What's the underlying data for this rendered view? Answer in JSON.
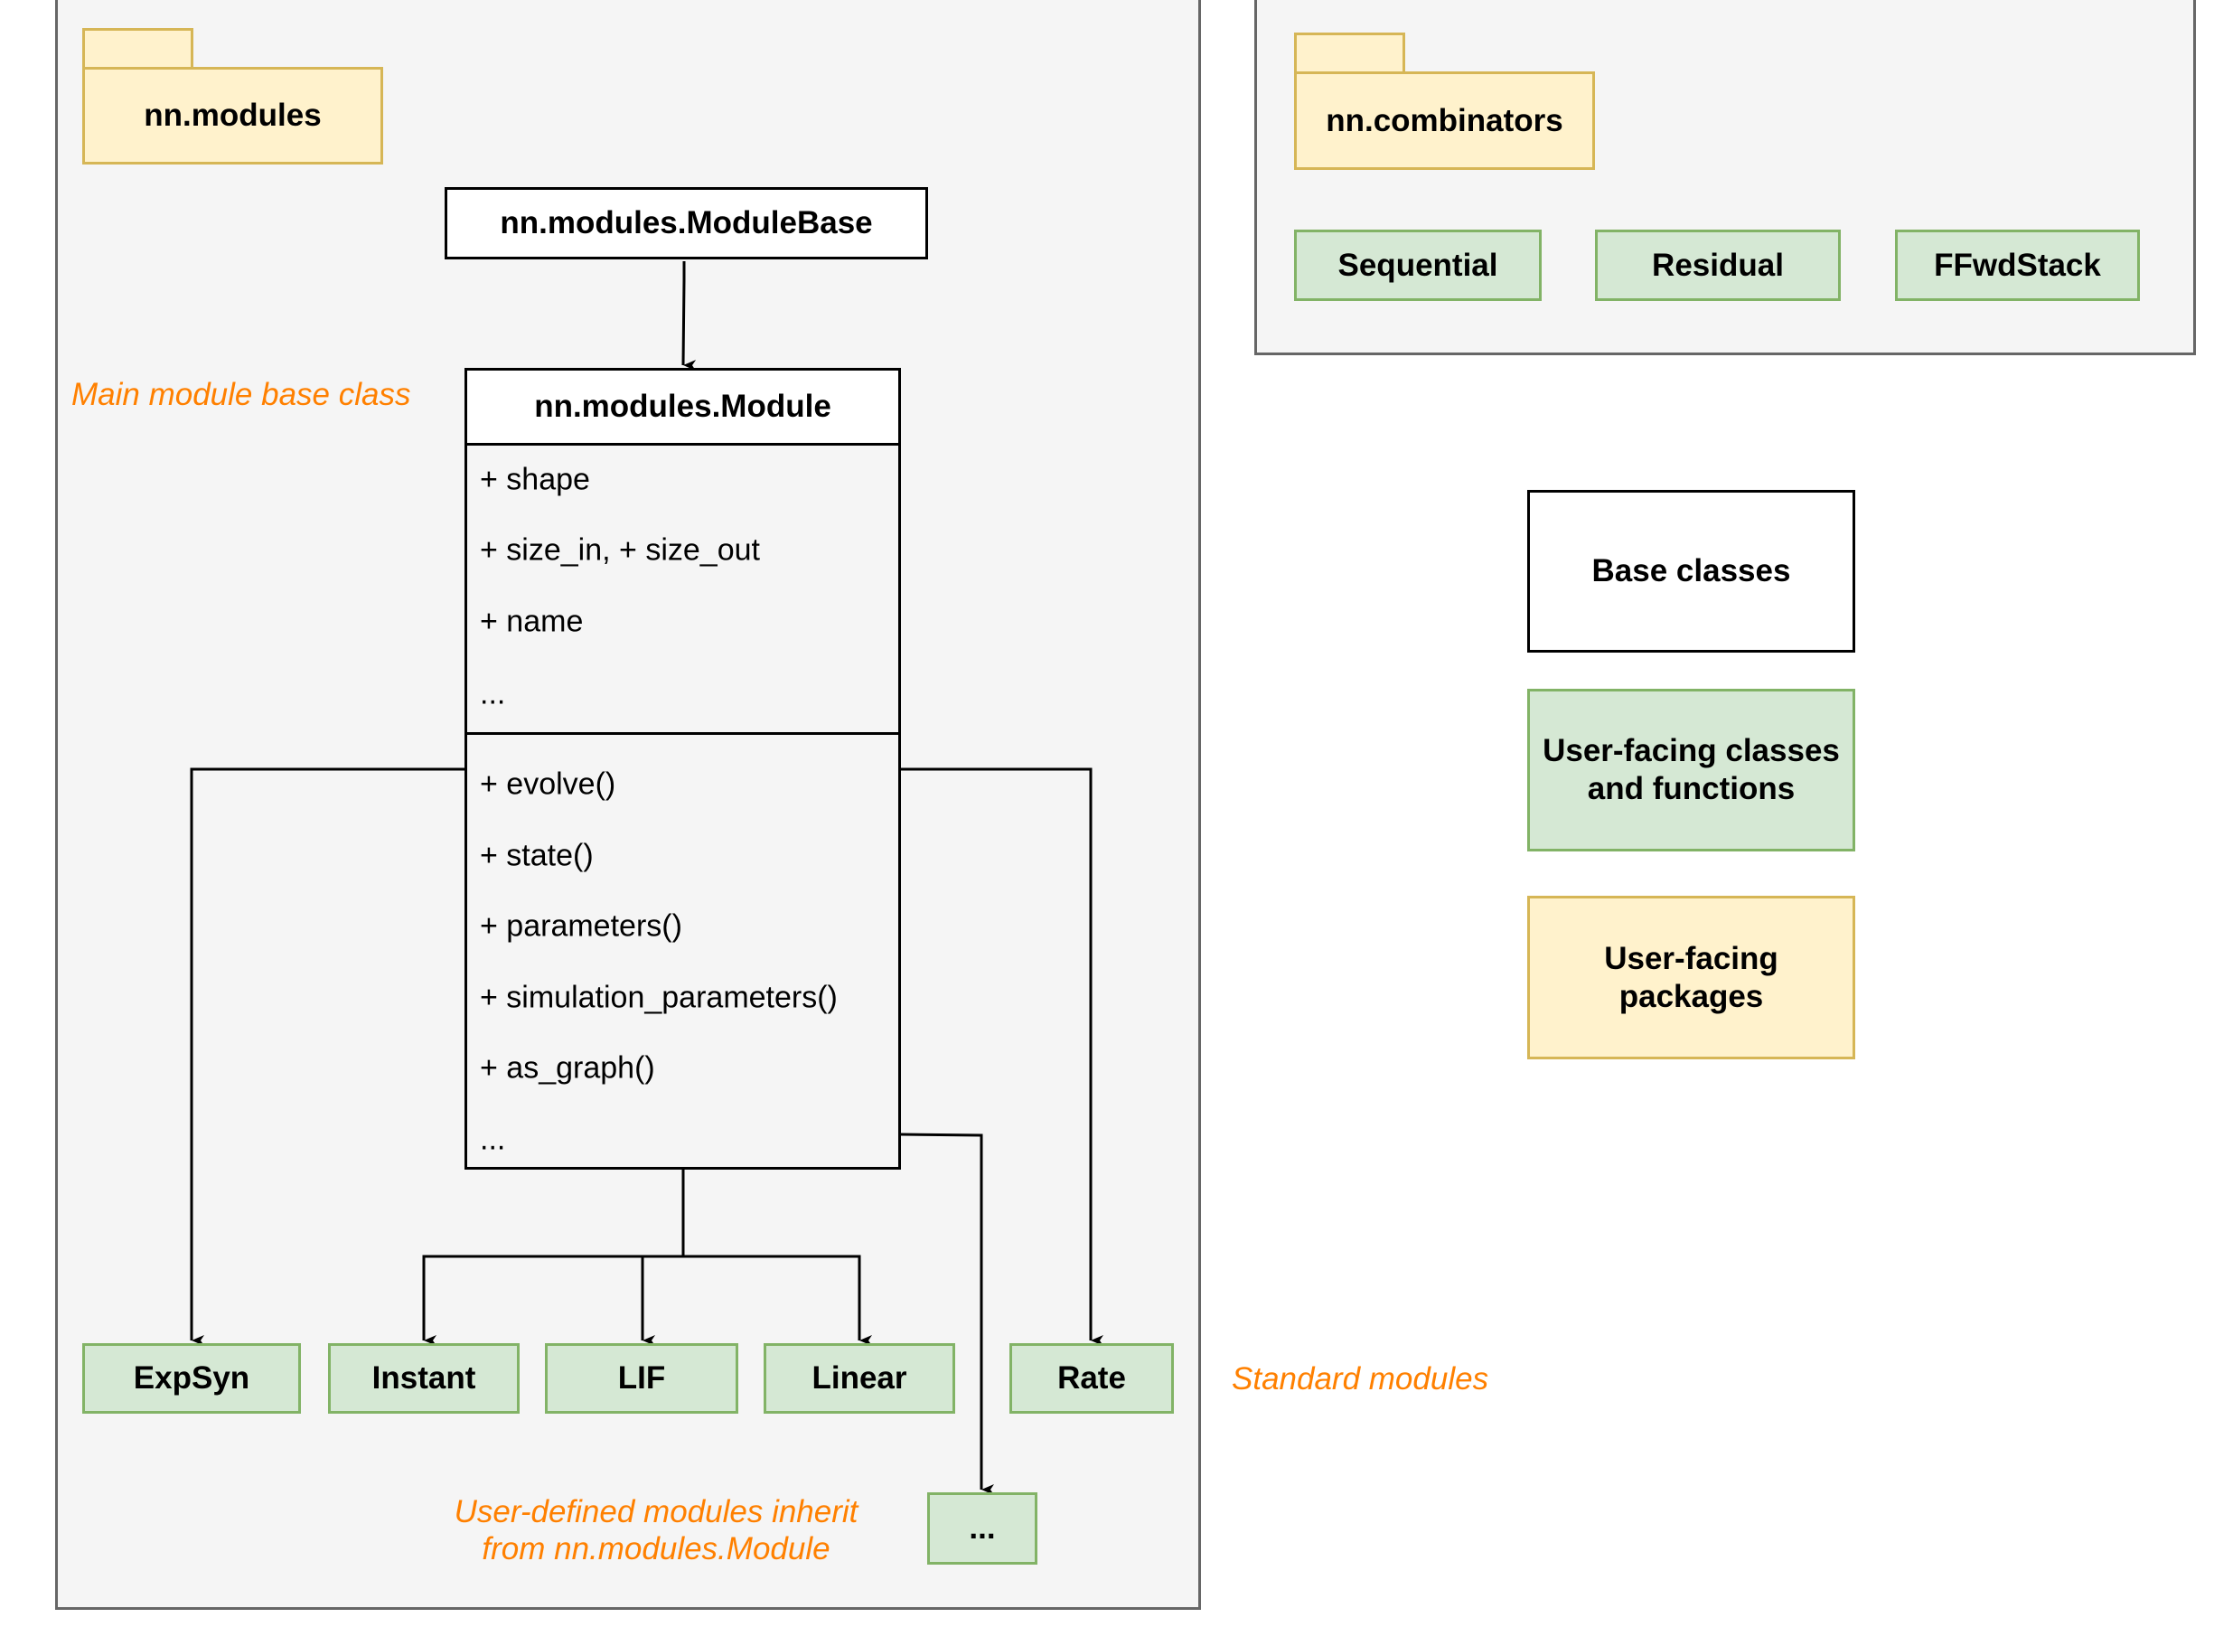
{
  "modules_frame": {
    "package_label": "nn.modules",
    "base_class": "nn.modules.ModuleBase",
    "module_class": {
      "title": "nn.modules.Module",
      "attributes": [
        "+ shape",
        "+ size_in, + size_out",
        "+ name",
        "..."
      ],
      "methods": [
        "+ evolve()",
        "+ state()",
        "+ parameters()",
        "+ simulation_parameters()",
        "+ as_graph()",
        "..."
      ]
    },
    "standard_modules": [
      "ExpSyn",
      "Instant",
      "LIF",
      "Linear",
      "Rate"
    ],
    "user_defined_placeholder": "...",
    "notes": {
      "main_base": "Main module base class",
      "standard": "Standard modules",
      "user_defined_line1": "User-defined modules inherit",
      "user_defined_line2": "from nn.modules.Module"
    }
  },
  "combinators_frame": {
    "package_label": "nn.combinators",
    "items": [
      "Sequential",
      "Residual",
      "FFwdStack"
    ]
  },
  "legend": {
    "base": "Base classes",
    "user_classes_line1": "User-facing classes",
    "user_classes_line2": "and functions",
    "packages_line1": "User-facing",
    "packages_line2": "packages"
  },
  "colors": {
    "frame_fill": "#f5f5f5",
    "frame_border": "#666666",
    "package_fill": "#fff2cc",
    "package_border": "#d6b656",
    "class_fill": "#d5e8d4",
    "class_border": "#82b366",
    "note_text": "#ff8000"
  }
}
